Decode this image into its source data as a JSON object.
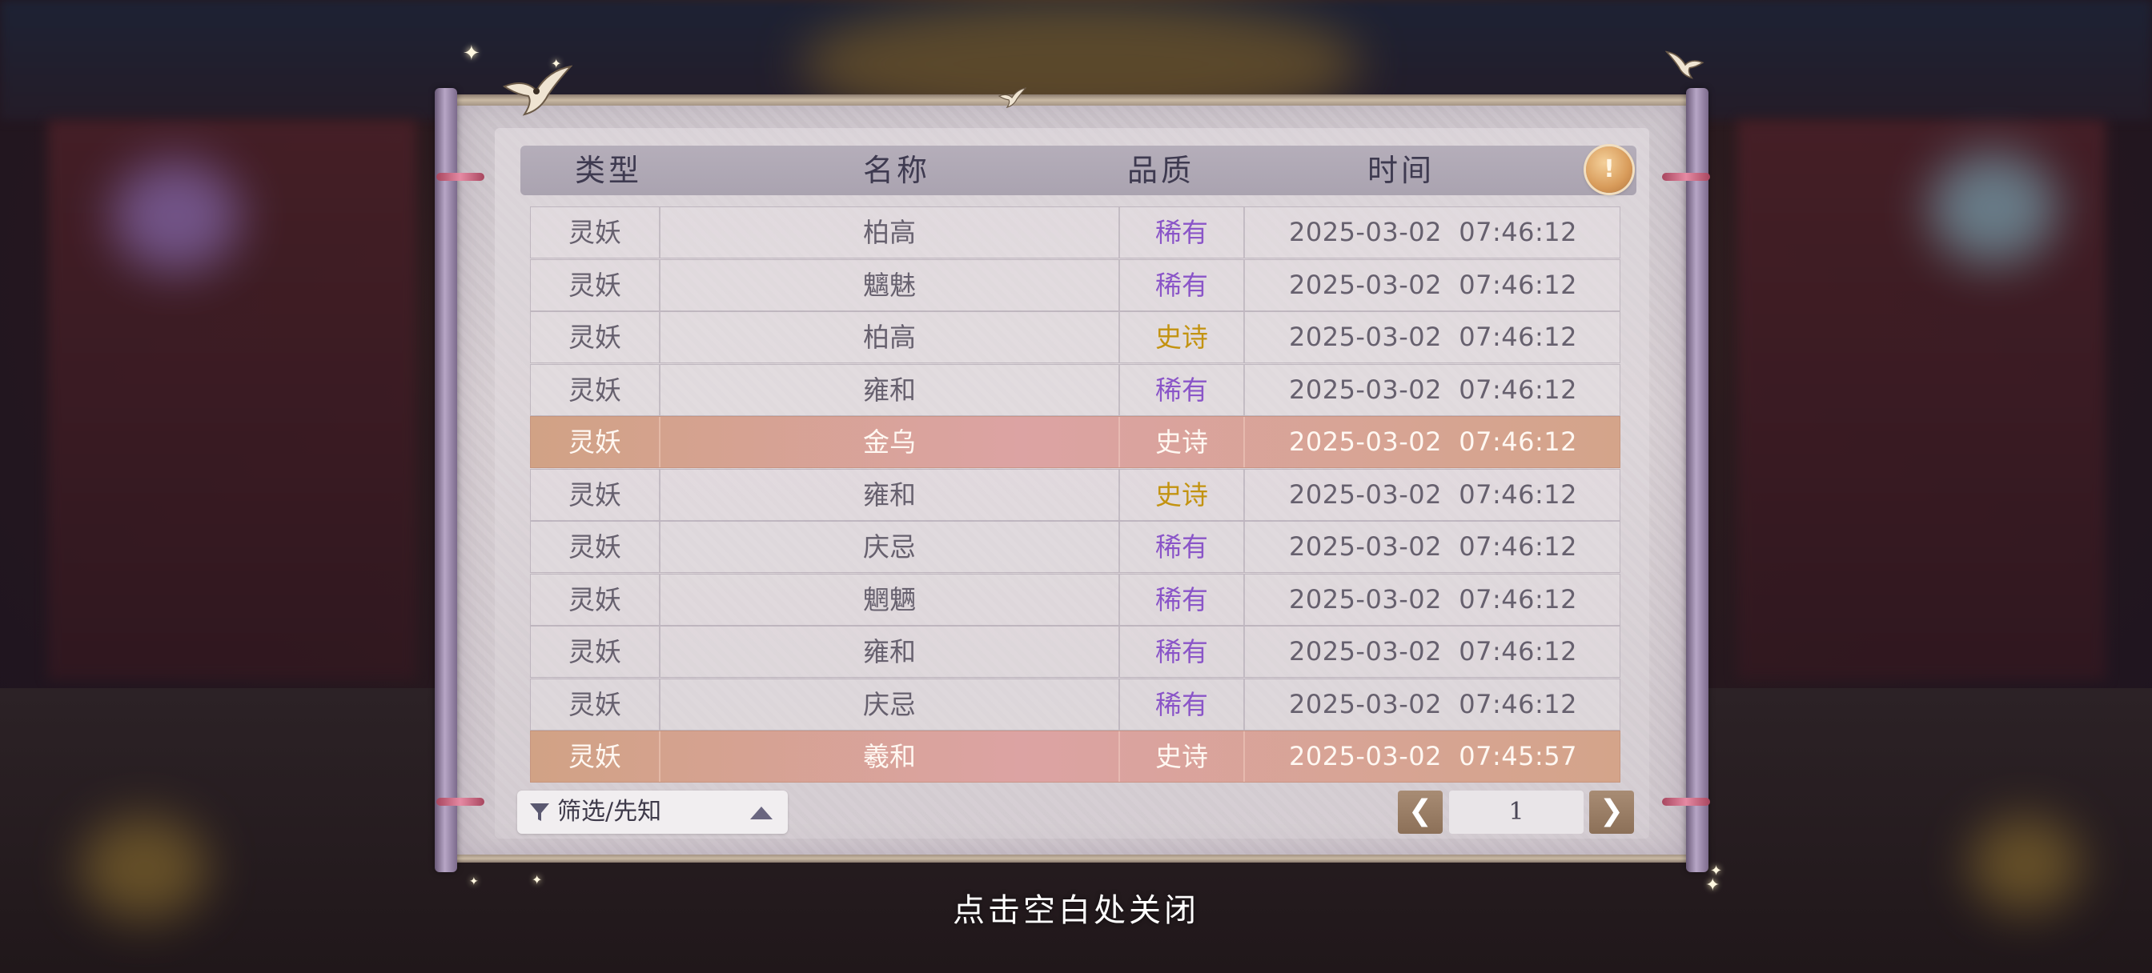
{
  "header": {
    "col_type": "类型",
    "col_name": "名称",
    "col_quality": "品质",
    "col_time": "时间"
  },
  "info_button": {
    "icon": "lightbulb-icon",
    "symbol": "!"
  },
  "rows": [
    {
      "type": "灵妖",
      "name": "柏高",
      "quality": "稀有",
      "date": "2025-03-02",
      "time": "07:46:12",
      "quality_class": "rare",
      "highlight": false
    },
    {
      "type": "灵妖",
      "name": "魑魅",
      "quality": "稀有",
      "date": "2025-03-02",
      "time": "07:46:12",
      "quality_class": "rare",
      "highlight": false
    },
    {
      "type": "灵妖",
      "name": "柏高",
      "quality": "史诗",
      "date": "2025-03-02",
      "time": "07:46:12",
      "quality_class": "epic",
      "highlight": false
    },
    {
      "type": "灵妖",
      "name": "雍和",
      "quality": "稀有",
      "date": "2025-03-02",
      "time": "07:46:12",
      "quality_class": "rare",
      "highlight": false
    },
    {
      "type": "灵妖",
      "name": "金乌",
      "quality": "史诗",
      "date": "2025-03-02",
      "time": "07:46:12",
      "quality_class": "epic",
      "highlight": true
    },
    {
      "type": "灵妖",
      "name": "雍和",
      "quality": "史诗",
      "date": "2025-03-02",
      "time": "07:46:12",
      "quality_class": "epic",
      "highlight": false
    },
    {
      "type": "灵妖",
      "name": "庆忌",
      "quality": "稀有",
      "date": "2025-03-02",
      "time": "07:46:12",
      "quality_class": "rare",
      "highlight": false
    },
    {
      "type": "灵妖",
      "name": "魍魉",
      "quality": "稀有",
      "date": "2025-03-02",
      "time": "07:46:12",
      "quality_class": "rare",
      "highlight": false
    },
    {
      "type": "灵妖",
      "name": "雍和",
      "quality": "稀有",
      "date": "2025-03-02",
      "time": "07:46:12",
      "quality_class": "rare",
      "highlight": false
    },
    {
      "type": "灵妖",
      "name": "庆忌",
      "quality": "稀有",
      "date": "2025-03-02",
      "time": "07:46:12",
      "quality_class": "rare",
      "highlight": false
    },
    {
      "type": "灵妖",
      "name": "羲和",
      "quality": "史诗",
      "date": "2025-03-02",
      "time": "07:45:57",
      "quality_class": "epic",
      "highlight": true
    }
  ],
  "filter": {
    "label": "筛选/先知",
    "icon": "filter-icon",
    "caret_icon": "caret-up-icon"
  },
  "pagination": {
    "prev_symbol": "❮",
    "current_page": "1",
    "next_symbol": "❯"
  },
  "close_hint": "点击空白处关闭",
  "colors": {
    "rare": "#8a55c8",
    "epic": "#c39311",
    "highlight_row": "#dca3a3",
    "header_bg": "#aaa3b0"
  }
}
